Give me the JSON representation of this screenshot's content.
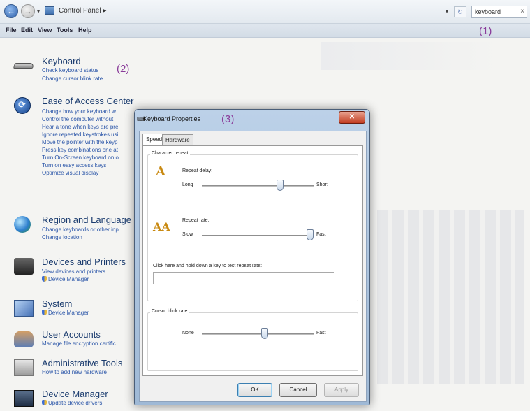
{
  "addressbar": {
    "breadcrumb": "Control Panel ▸",
    "search_value": "keyboard",
    "nav_back": "←",
    "nav_forward": "→",
    "refresh": "↻",
    "clear": "×"
  },
  "menubar": {
    "items": [
      "File",
      "Edit",
      "View",
      "Tools",
      "Help"
    ]
  },
  "annotations": {
    "a1": "(1)",
    "a2": "(2)",
    "a3": "(3)"
  },
  "results": [
    {
      "title": "Keyboard",
      "icon": "keyboard-icon",
      "links": [
        "Check keyboard status",
        "Change cursor blink rate"
      ]
    },
    {
      "title": "Ease of Access Center",
      "icon": "ease-of-access-icon",
      "links": [
        "Change how your keyboard w",
        "Control the computer without",
        "Hear a tone when keys are pre",
        "Ignore repeated keystrokes usi",
        "Move the pointer with the keyp",
        "Press key combinations one at",
        "Turn On-Screen keyboard on o",
        "Turn on easy access keys",
        "Optimize visual display"
      ]
    },
    {
      "title": "Region and Language",
      "icon": "globe-icon",
      "links": [
        "Change keyboards or other inp",
        "Change location"
      ]
    },
    {
      "title": "Devices and Printers",
      "icon": "devices-printers-icon",
      "links": [
        "View devices and printers",
        "Device Manager"
      ]
    },
    {
      "title": "System",
      "icon": "system-icon",
      "links": [
        "Device Manager"
      ]
    },
    {
      "title": "User Accounts",
      "icon": "user-accounts-icon",
      "links": [
        "Manage file encryption certific"
      ]
    },
    {
      "title": "Administrative Tools",
      "icon": "admin-tools-icon",
      "links": [
        "How to add new hardware"
      ]
    },
    {
      "title": "Device Manager",
      "icon": "device-manager-icon",
      "links": [
        "Update device drivers"
      ]
    }
  ],
  "dialog": {
    "title": "Keyboard Properties",
    "close": "✕",
    "tabs": [
      "Speed",
      "Hardware"
    ],
    "character_repeat": {
      "group_label": "Character repeat",
      "repeat_delay_label": "Repeat delay:",
      "delay_min": "Long",
      "delay_max": "Short",
      "delay_level": 0.7,
      "repeat_rate_label": "Repeat rate:",
      "rate_min": "Slow",
      "rate_max": "Fast",
      "rate_level": 0.97,
      "test_label": "Click here and hold down a key to test repeat rate:",
      "test_value": ""
    },
    "cursor_blink": {
      "group_label": "Cursor blink rate",
      "min": "None",
      "max": "Fast",
      "level": 0.56
    },
    "buttons": {
      "ok": "OK",
      "cancel": "Cancel",
      "apply": "Apply"
    }
  },
  "colors": {
    "link": "#2a55a8",
    "title": "#1a3b6e",
    "annotation": "#8a3c9a"
  }
}
